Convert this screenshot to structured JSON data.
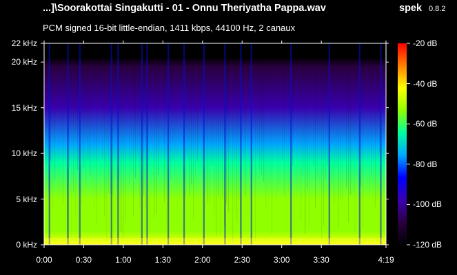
{
  "header": {
    "title": "...]\\Soorakottai Singakutti - 01 - Onnu Theriyatha Pappa.wav",
    "app_name": "spek",
    "version": "0.8.2",
    "info": "PCM signed 16-bit little-endian, 1411 kbps, 44100 Hz, 2 canaux"
  },
  "chart_data": {
    "type": "heatmap",
    "title": "...]\\Soorakottai Singakutti - 01 - Onnu Theriyatha Pappa.wav",
    "xlabel": "",
    "ylabel": "",
    "x_unit": "seconds",
    "xlim": [
      0,
      259
    ],
    "ylim": [
      0,
      22050
    ],
    "x_ticks": [
      {
        "label": "0:00",
        "value": 0
      },
      {
        "label": "0:30",
        "value": 30
      },
      {
        "label": "1:00",
        "value": 60
      },
      {
        "label": "1:30",
        "value": 90
      },
      {
        "label": "2:00",
        "value": 120
      },
      {
        "label": "2:30",
        "value": 150
      },
      {
        "label": "3:00",
        "value": 180
      },
      {
        "label": "3:30",
        "value": 210
      },
      {
        "label": "4:19",
        "value": 259
      }
    ],
    "y_ticks": [
      {
        "label": "0 kHz",
        "value": 0
      },
      {
        "label": "5 kHz",
        "value": 5000
      },
      {
        "label": "10 kHz",
        "value": 10000
      },
      {
        "label": "15 kHz",
        "value": 15000
      },
      {
        "label": "20 kHz",
        "value": 20000
      },
      {
        "label": "22 kHz",
        "value": 22050
      }
    ],
    "colorbar": {
      "range_db": [
        -120,
        -20
      ],
      "ticks": [
        {
          "label": "-20 dB",
          "value": -20
        },
        {
          "label": "-40 dB",
          "value": -40
        },
        {
          "label": "-60 dB",
          "value": -60
        },
        {
          "label": "-80 dB",
          "value": -80
        },
        {
          "label": "-100 dB",
          "value": -100
        },
        {
          "label": "-120 dB",
          "value": -120
        }
      ],
      "colors": [
        "#000000",
        "#2a0040",
        "#3a00b0",
        "#0000ff",
        "#00a8ff",
        "#00ffa0",
        "#90ff00",
        "#ffff00",
        "#ff8000",
        "#ff0000"
      ]
    },
    "profile_db": [
      {
        "freq": 0,
        "db": -42
      },
      {
        "freq": 1500,
        "db": -50
      },
      {
        "freq": 5000,
        "db": -58
      },
      {
        "freq": 9000,
        "db": -66
      },
      {
        "freq": 11000,
        "db": -80
      },
      {
        "freq": 15000,
        "db": -93
      },
      {
        "freq": 19500,
        "db": -106
      },
      {
        "freq": 20500,
        "db": -116
      },
      {
        "freq": 22050,
        "db": -125
      }
    ],
    "dips_sec": [
      4,
      18,
      27,
      51,
      56,
      74,
      78,
      94,
      106,
      121,
      137,
      149,
      157,
      187,
      216,
      239,
      255
    ]
  }
}
